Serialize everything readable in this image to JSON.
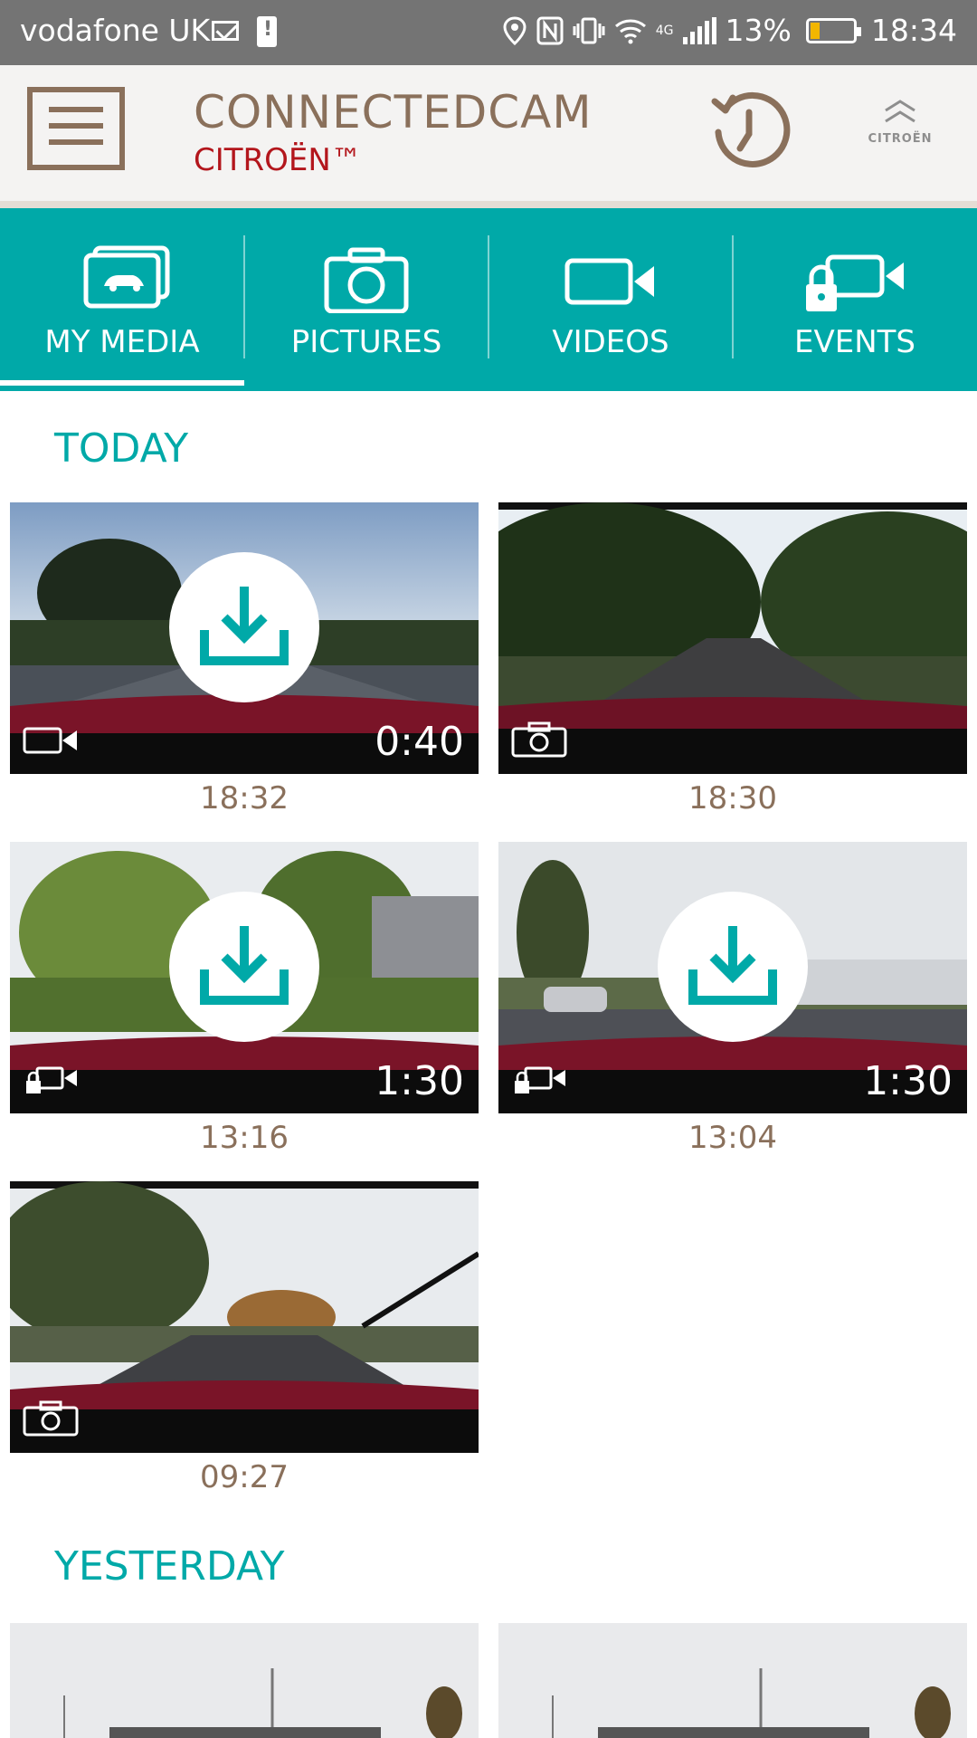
{
  "status_bar": {
    "carrier": "vodafone UK",
    "network": "4G",
    "battery_percent": "13%",
    "battery_level": 0.13,
    "time": "18:34",
    "icons": [
      "mail-icon",
      "sd-alert-icon",
      "location-icon",
      "nfc-icon",
      "vibrate-icon",
      "wifi-icon",
      "signal-icon",
      "battery-icon"
    ]
  },
  "header": {
    "title": "CONNECTEDCAM",
    "subtitle": "CITROËN™",
    "logo_text": "CITROËN",
    "colors": {
      "title": "#8a705b",
      "subtitle": "#b3161c"
    }
  },
  "tabs": [
    {
      "label": "MY MEDIA",
      "icon": "media-icon",
      "active": true
    },
    {
      "label": "PICTURES",
      "icon": "camera-icon",
      "active": false
    },
    {
      "label": "VIDEOS",
      "icon": "video-icon",
      "active": false
    },
    {
      "label": "EVENTS",
      "icon": "locked-video-icon",
      "active": false
    }
  ],
  "accent_color": "#00a9a8",
  "sections": [
    {
      "title": "TODAY",
      "items": [
        {
          "time": "18:32",
          "type": "video",
          "duration": "0:40",
          "download": true
        },
        {
          "time": "18:30",
          "type": "picture",
          "duration": "",
          "download": false
        },
        {
          "time": "13:16",
          "type": "event",
          "duration": "1:30",
          "download": true
        },
        {
          "time": "13:04",
          "type": "event",
          "duration": "1:30",
          "download": true
        },
        {
          "time": "09:27",
          "type": "picture",
          "duration": "",
          "download": false
        }
      ]
    },
    {
      "title": "YESTERDAY",
      "items": []
    }
  ]
}
